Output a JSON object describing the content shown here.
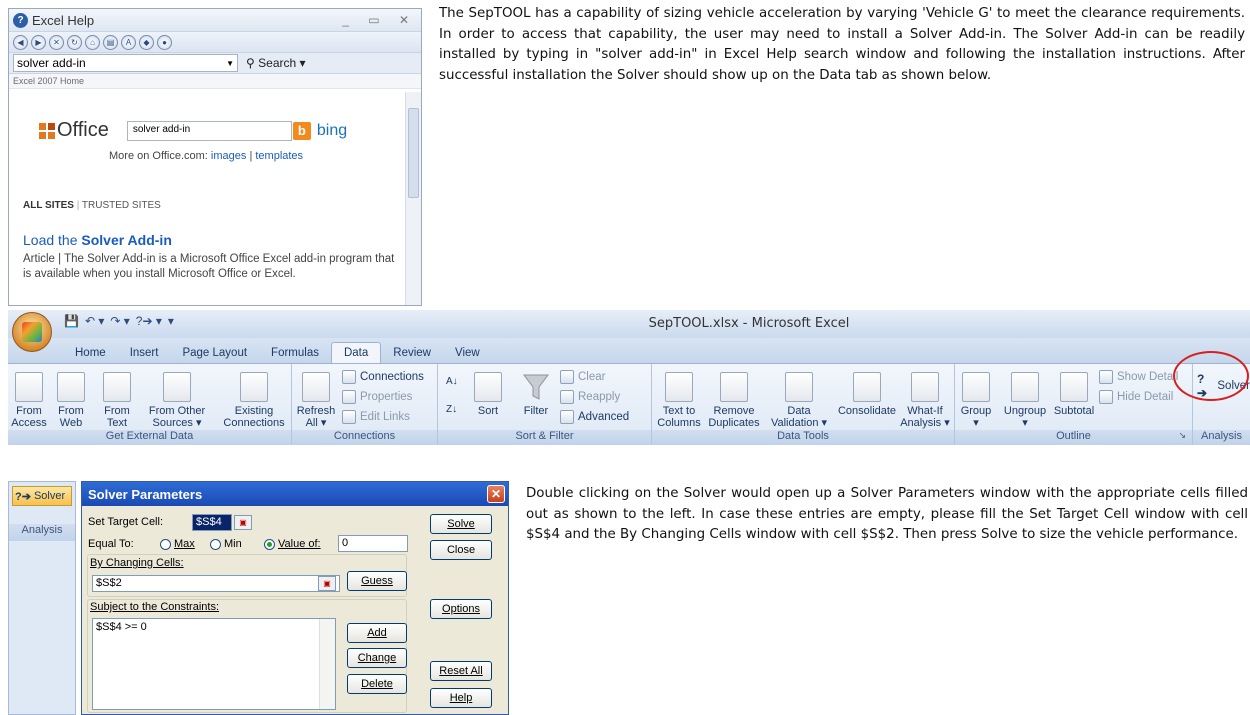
{
  "help": {
    "title": "Excel Help",
    "search_value": "solver add-in",
    "search_button": "Search",
    "breadcrumb": "Excel 2007 Home",
    "office_logo": "Office",
    "office_search_value": "solver add-in",
    "bing_label": "bing",
    "more_prefix": "More on Office.com:",
    "more_images": "images",
    "more_sep": "|",
    "more_templates": "templates",
    "all_sites": "ALL SITES",
    "trusted_sites": "TRUSTED SITES",
    "result_title_prefix": "Load the ",
    "result_title_bold": "Solver Add-in",
    "result_desc": "Article | The Solver Add-in is a Microsoft Office Excel add-in program that is available when you install Microsoft Office or Excel."
  },
  "paragraph1": "The SepTOOL has a capability of sizing vehicle acceleration by varying 'Vehicle G' to meet the clearance requirements. In order to access that capability, the user may need to install a Solver Add-in. The Solver Add-in can be readily installed by typing in \"solver add-in\" in Excel Help search window and following the installation instructions. After successful installation the Solver should show up on the Data tab as shown below.",
  "excel": {
    "title": "SepTOOL.xlsx - Microsoft Excel",
    "tabs": [
      "Home",
      "Insert",
      "Page Layout",
      "Formulas",
      "Data",
      "Review",
      "View"
    ],
    "active_tab": "Data",
    "get_external": {
      "name": "Get External Data",
      "from_access": [
        "From",
        "Access"
      ],
      "from_web": [
        "From",
        "Web"
      ],
      "from_text": [
        "From",
        "Text"
      ],
      "from_other": [
        "From Other",
        "Sources ▾"
      ],
      "existing": [
        "Existing",
        "Connections"
      ]
    },
    "connections": {
      "name": "Connections",
      "refresh": [
        "Refresh",
        "All ▾"
      ],
      "connections": "Connections",
      "properties": "Properties",
      "edit_links": "Edit Links"
    },
    "sort_filter": {
      "name": "Sort & Filter",
      "sort": "Sort",
      "filter": "Filter",
      "clear": "Clear",
      "reapply": "Reapply",
      "advanced": "Advanced"
    },
    "data_tools": {
      "name": "Data Tools",
      "text_to_columns": [
        "Text to",
        "Columns"
      ],
      "remove_duplicates": [
        "Remove",
        "Duplicates"
      ],
      "data_validation": [
        "Data",
        "Validation ▾"
      ],
      "consolidate": "Consolidate",
      "what_if": [
        "What-If",
        "Analysis ▾"
      ]
    },
    "outline": {
      "name": "Outline",
      "group": "Group",
      "ungroup": "Ungroup",
      "subtotal": "Subtotal",
      "show_detail": "Show Detail",
      "hide_detail": "Hide Detail"
    },
    "analysis": {
      "name": "Analysis",
      "solver": "Solver"
    }
  },
  "solver_side": {
    "button": "Solver",
    "group_label": "Analysis"
  },
  "dialog": {
    "title": "Solver Parameters",
    "set_target_label": "Set Target Cell:",
    "set_target_value": "$S$4",
    "equal_to_label": "Equal To:",
    "opt_max": "Max",
    "opt_min": "Min",
    "opt_value": "Value of:",
    "value_of": "0",
    "changing_label": "By Changing Cells:",
    "changing_value": "$S$2",
    "constraints_label": "Subject to the Constraints:",
    "constraint_1": "$S$4 >= 0",
    "btn_solve": "Solve",
    "btn_close": "Close",
    "btn_guess": "Guess",
    "btn_options": "Options",
    "btn_add": "Add",
    "btn_change": "Change",
    "btn_delete": "Delete",
    "btn_reset": "Reset All",
    "btn_help": "Help"
  },
  "paragraph2": "Double clicking on the Solver would open up a Solver Parameters window with the appropriate cells filled out as shown to the left. In case these entries are empty, please fill the Set Target Cell window with cell $S$4 and the By Changing Cells window with cell $S$2. Then press Solve to size the vehicle performance.",
  "colors": {
    "highlight": "#d62020",
    "dialog_title": "#2f6cd6",
    "link": "#1a5bbf"
  }
}
